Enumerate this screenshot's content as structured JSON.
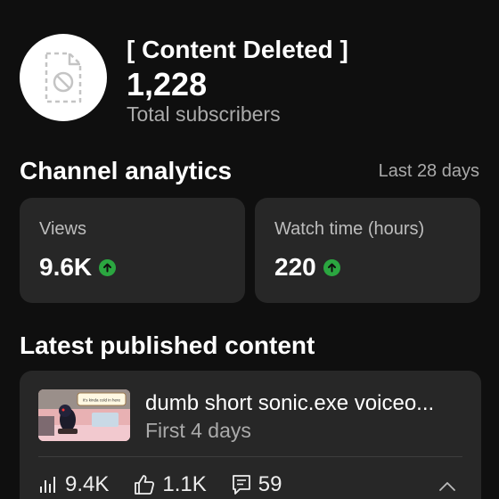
{
  "channel": {
    "name": "[ Content Deleted ]",
    "subscriber_count": "1,228",
    "subscriber_label": "Total subscribers",
    "avatar_icon": "content-deleted-icon"
  },
  "analytics": {
    "title": "Channel analytics",
    "range": "Last 28 days",
    "cards": [
      {
        "label": "Views",
        "value": "9.6K",
        "trend": "up",
        "trend_icon": "trend-up-icon",
        "trend_color": "#2ba640"
      },
      {
        "label": "Watch time (hours)",
        "value": "220",
        "trend": "up",
        "trend_icon": "trend-up-icon",
        "trend_color": "#2ba640"
      }
    ]
  },
  "latest": {
    "title": "Latest published content",
    "video": {
      "title": "dumb short sonic.exe voiceo...",
      "subtitle": "First 4 days",
      "thumbnail_caption": "It's kinda cold in here",
      "stats": [
        {
          "icon": "views-bars-icon",
          "value": "9.4K"
        },
        {
          "icon": "thumbs-up-icon",
          "value": "1.1K"
        },
        {
          "icon": "comment-icon",
          "value": "59"
        }
      ],
      "expand_icon": "chevron-up-icon"
    }
  },
  "colors": {
    "background": "#0f0f0f",
    "card": "#272727",
    "accent_up": "#2ba640",
    "muted_text": "#aaaaaa"
  }
}
